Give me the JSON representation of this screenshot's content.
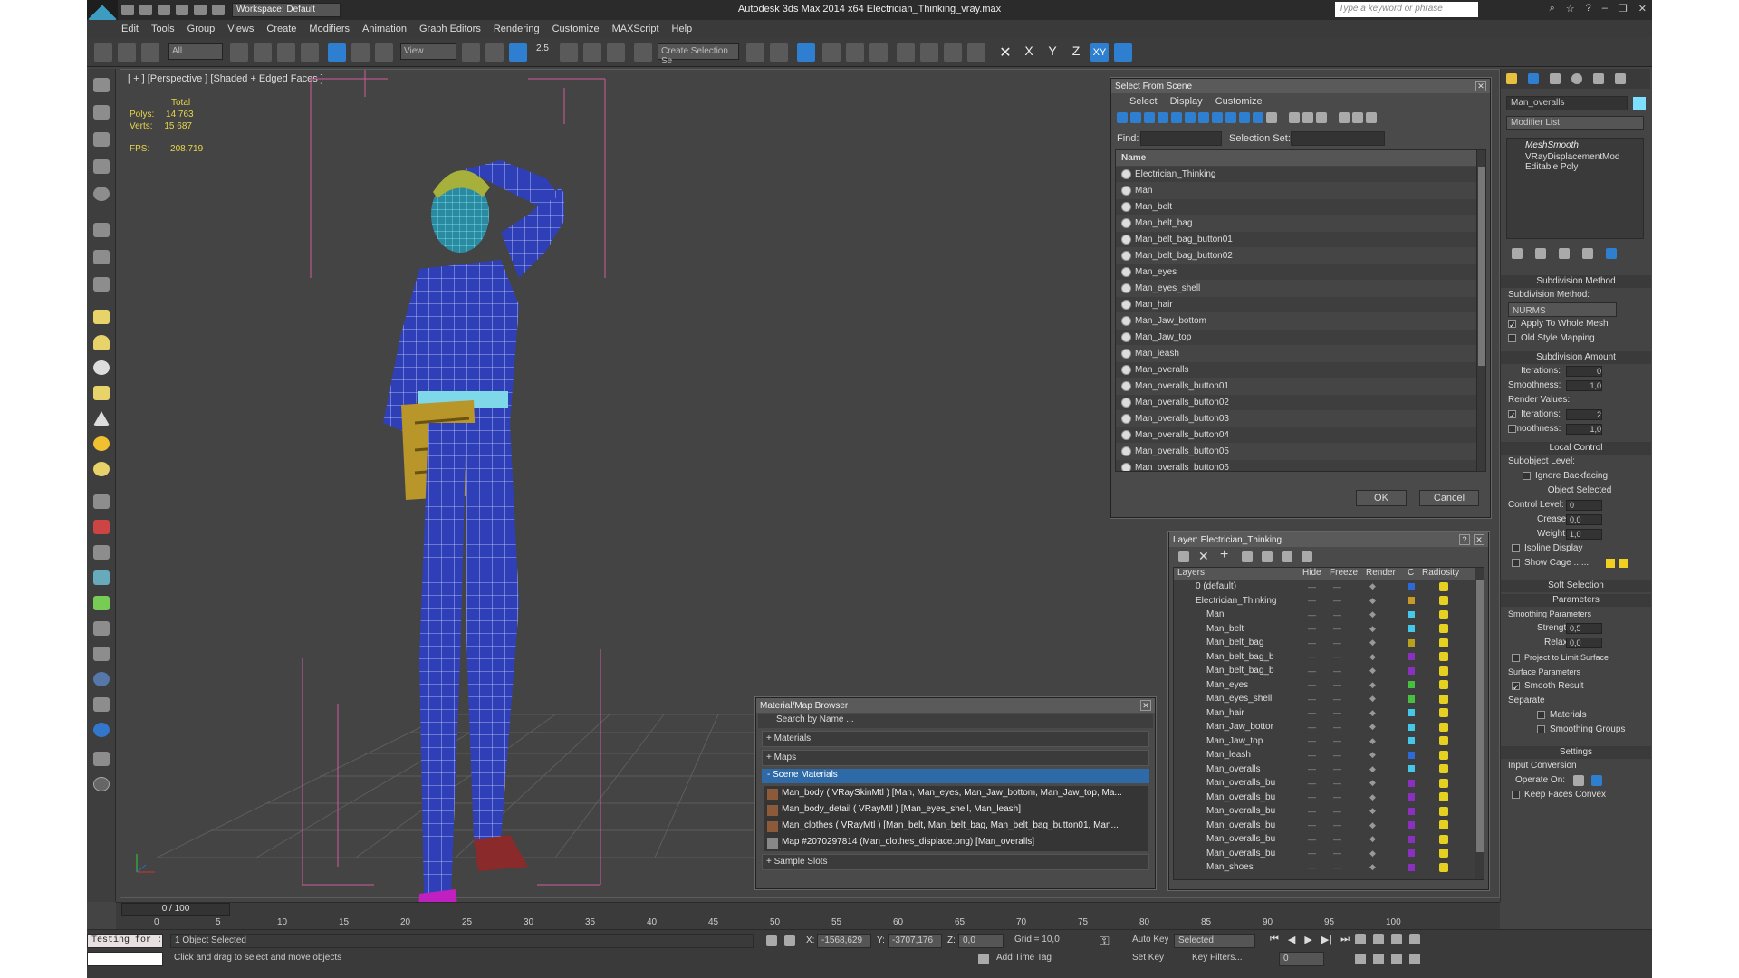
{
  "app": {
    "title": "Autodesk 3ds Max  2014 x64     Electrician_Thinking_vray.max",
    "workspace": "Workspace: Default",
    "search_placeholder": "Type a keyword or phrase"
  },
  "menu": [
    "Edit",
    "Tools",
    "Group",
    "Views",
    "Create",
    "Modifiers",
    "Animation",
    "Graph Editors",
    "Rendering",
    "Customize",
    "MAXScript",
    "Help"
  ],
  "toolbar": {
    "filter": "All",
    "view": "View",
    "angle": "2.5",
    "create_selection": "Create Selection Se",
    "axes": [
      "X",
      "Y",
      "Z",
      "XY"
    ]
  },
  "viewport": {
    "label": "[ + ] [Perspective ] [Shaded + Edged Faces ]",
    "stats": {
      "total": "Total",
      "polys_label": "Polys:",
      "polys": "14 763",
      "verts_label": "Verts:",
      "verts": "15 687",
      "fps_label": "FPS:",
      "fps": "208,719"
    }
  },
  "select_from_scene": {
    "title": "Select From Scene",
    "tabs": [
      "Select",
      "Display",
      "Customize"
    ],
    "find_label": "Find:",
    "selection_set_label": "Selection Set:",
    "column": "Name",
    "items": [
      "Electrician_Thinking",
      "Man",
      "Man_belt",
      "Man_belt_bag",
      "Man_belt_bag_button01",
      "Man_belt_bag_button02",
      "Man_eyes",
      "Man_eyes_shell",
      "Man_hair",
      "Man_Jaw_bottom",
      "Man_Jaw_top",
      "Man_leash",
      "Man_overalls",
      "Man_overalls_button01",
      "Man_overalls_button02",
      "Man_overalls_button03",
      "Man_overalls_button04",
      "Man_overalls_button05",
      "Man_overalls_button06"
    ],
    "ok": "OK",
    "cancel": "Cancel"
  },
  "layer_dialog": {
    "title": "Layer: Electrician_Thinking",
    "columns": [
      "Layers",
      "Hide",
      "Freeze",
      "Render",
      "C",
      "Radiosity"
    ],
    "rows": [
      {
        "name": "0 (default)",
        "color": "#2c6bd6"
      },
      {
        "name": "Electrician_Thinking",
        "color": "#c89a2a"
      },
      {
        "name": "Man",
        "color": "#45c8e8"
      },
      {
        "name": "Man_belt",
        "color": "#45c8e8"
      },
      {
        "name": "Man_belt_bag",
        "color": "#b8a21c"
      },
      {
        "name": "Man_belt_bag_b",
        "color": "#8a2fc0"
      },
      {
        "name": "Man_belt_bag_b",
        "color": "#8a2fc0"
      },
      {
        "name": "Man_eyes",
        "color": "#47c040"
      },
      {
        "name": "Man_eyes_shell",
        "color": "#47c040"
      },
      {
        "name": "Man_hair",
        "color": "#45c8e8"
      },
      {
        "name": "Man_Jaw_bottor",
        "color": "#45c8e8"
      },
      {
        "name": "Man_Jaw_top",
        "color": "#45c8e8"
      },
      {
        "name": "Man_leash",
        "color": "#2c6bd6"
      },
      {
        "name": "Man_overalls",
        "color": "#45c8e8"
      },
      {
        "name": "Man_overalls_bu",
        "color": "#8a2fc0"
      },
      {
        "name": "Man_overalls_bu",
        "color": "#8a2fc0"
      },
      {
        "name": "Man_overalls_bu",
        "color": "#8a2fc0"
      },
      {
        "name": "Man_overalls_bu",
        "color": "#8a2fc0"
      },
      {
        "name": "Man_overalls_bu",
        "color": "#8a2fc0"
      },
      {
        "name": "Man_overalls_bu",
        "color": "#8a2fc0"
      },
      {
        "name": "Man_shoes",
        "color": "#8a2fc0"
      }
    ]
  },
  "material_browser": {
    "title": "Material/Map Browser",
    "search": "Search by Name ...",
    "groups": [
      "+ Materials",
      "+ Maps",
      "- Scene Materials",
      "+ Sample Slots"
    ],
    "scene_materials": [
      "Man_body  ( VRaySkinMtl )  [Man, Man_eyes, Man_Jaw_bottom, Man_Jaw_top, Ma...",
      "Man_body_detail  ( VRayMtl )  [Man_eyes_shell, Man_leash]",
      "Man_clothes  ( VRayMtl )  [Man_belt, Man_belt_bag, Man_belt_bag_button01, Man...",
      "Map #2070297814 (Man_clothes_displace.png)  [Man_overalls]"
    ]
  },
  "command_panel": {
    "object_name": "Man_overalls",
    "modifier_list": "Modifier List",
    "stack": [
      "MeshSmooth",
      "VRayDisplacementMod",
      "Editable Poly"
    ],
    "subdivision_method": {
      "head": "Subdivision Method",
      "label": "Subdivision Method:",
      "value": "NURMS",
      "apply": "Apply To Whole Mesh",
      "old": "Old Style Mapping"
    },
    "subdivision_amount": {
      "head": "Subdivision Amount",
      "iterations_label": "Iterations:",
      "iterations": "0",
      "smoothness_label": "Smoothness:",
      "smoothness": "1,0",
      "render_values": "Render Values:",
      "r_iterations": "2",
      "r_smoothness": "1,0"
    },
    "local_control": {
      "head": "Local Control",
      "subobject": "Subobject Level:",
      "ignore": "Ignore Backfacing",
      "selected": "Object Selected",
      "control_label": "Control Level:",
      "control": "0",
      "crease_label": "Crease:",
      "crease": "0,0",
      "weight_label": "Weight:",
      "weight": "1,0",
      "isoline": "Isoline Display",
      "cage": "Show Cage ......"
    },
    "soft_selection": "Soft Selection",
    "parameters": {
      "head": "Parameters",
      "smoothing": "Smoothing Parameters",
      "strength_label": "Strength:",
      "strength": "0,5",
      "relax_label": "Relax:",
      "relax": "0,0",
      "project": "Project to Limit Surface",
      "surface": "Surface Parameters",
      "smooth_result": "Smooth Result",
      "separate": "Separate",
      "materials": "Materials",
      "groups": "Smoothing Groups"
    },
    "settings": {
      "head": "Settings",
      "input_conversion": "Input Conversion",
      "operate_on": "Operate On:",
      "keep_faces": "Keep Faces Convex"
    }
  },
  "timeline": {
    "frame": "0 / 100",
    "ticks": [
      "0",
      "5",
      "10",
      "15",
      "20",
      "25",
      "30",
      "35",
      "40",
      "45",
      "50",
      "55",
      "60",
      "65",
      "70",
      "75",
      "80",
      "85",
      "90",
      "95",
      "100"
    ]
  },
  "status": {
    "script": "Testing for :",
    "selected": "1 Object Selected",
    "prompt": "Click and drag to select and move objects",
    "x_label": "X:",
    "x": "-1568,629",
    "y_label": "Y:",
    "y": "-3707,176",
    "z_label": "Z:",
    "z": "0,0",
    "grid": "Grid = 10,0",
    "add_time_tag": "Add Time Tag",
    "auto_key": "Auto Key",
    "set_key": "Set Key",
    "key_filters": "Key Filters...",
    "selected_dropdown": "Selected",
    "frame_field": "0"
  }
}
